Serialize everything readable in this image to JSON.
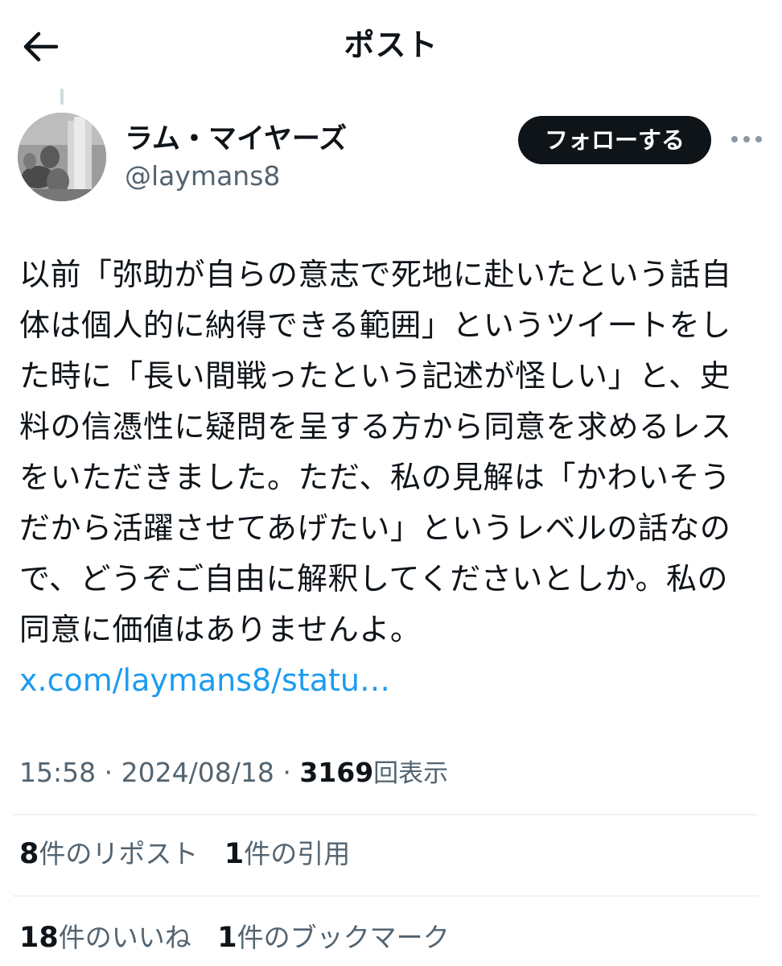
{
  "header": {
    "title": "ポスト",
    "back_icon": "arrow-left-icon"
  },
  "author": {
    "display_name": "ラム・マイヤーズ",
    "handle": "@laymans8",
    "follow_label": "フォローする",
    "more_icon": "more-horizontal-icon"
  },
  "tweet": {
    "lines": [
      "以前「弥助が自らの意志で死地に赴いたという話自",
      "体は個人的に納得できる範囲」というツイートをし",
      "た時に「長い間戦ったという記述が怪しい」と、史",
      "料の信憑性に疑問を呈する方から同意を求めるレス",
      "をいただきました。ただ、私の見解は「かわいそう",
      "だから活躍させてあげたい」というレベルの話なの",
      "で、どうぞご自由に解釈してくださいとしか。私の",
      "同意に価値はありませんよ。"
    ],
    "link": "x.com/laymans8/statu…"
  },
  "meta": {
    "time": "15:58",
    "separator": "·",
    "date": "2024/08/18",
    "views_count": "3169",
    "views_label": "回表示"
  },
  "stats": {
    "row1": [
      {
        "num": "8",
        "label": "件のリポスト"
      },
      {
        "num": "1",
        "label": "件の引用"
      }
    ],
    "row2": [
      {
        "num": "18",
        "label": "件のいいね"
      },
      {
        "num": "1",
        "label": "件のブックマーク"
      }
    ]
  },
  "colors": {
    "text": "#0f1419",
    "secondary": "#536471",
    "link": "#1d9bf0",
    "divider": "#eff3f4",
    "follow_bg": "#0f1419"
  }
}
